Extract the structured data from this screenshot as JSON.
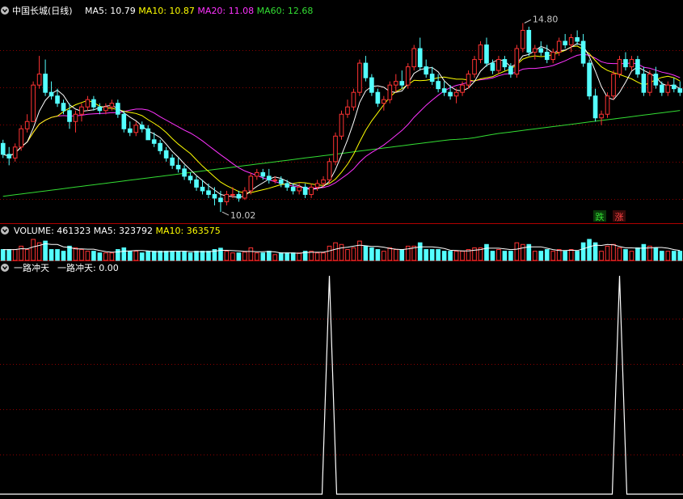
{
  "price_panel": {
    "title": "中国长城(日线)",
    "ma_labels": [
      {
        "text": "MA5: 10.79",
        "color": "#ffffff"
      },
      {
        "text": "MA10: 10.87",
        "color": "#ffff00"
      },
      {
        "text": "MA20: 11.08",
        "color": "#ff33ff"
      },
      {
        "text": "MA60: 12.68",
        "color": "#33dd33"
      }
    ],
    "high_label": "14.80",
    "low_label": "10.02",
    "badges": [
      {
        "text": "跌",
        "color": "#33dd33"
      },
      {
        "text": "涨",
        "color": "#ff4444"
      }
    ]
  },
  "volume_panel": {
    "labels": [
      {
        "text": "VOLUME: 461323",
        "color": "#ffffff"
      },
      {
        "text": "MA5: 323792",
        "color": "#ffffff"
      },
      {
        "text": "MA10: 363575",
        "color": "#ffff00"
      }
    ]
  },
  "indicator_panel": {
    "name": "一路冲天",
    "label": "一路冲天: 0.00"
  },
  "colors": {
    "up": "#ff3333",
    "down": "#54ffff",
    "ma5": "#ffffff",
    "ma10": "#ffff00",
    "ma20": "#ff33ff",
    "ma60": "#33dd33",
    "grid": "#8b0000"
  },
  "chart_data": [
    {
      "type": "candlestick",
      "series_name": "中国长城(日线)",
      "ylim": [
        9.8,
        15.3
      ],
      "candles": [
        [
          11.9,
          12.0,
          11.5,
          11.6
        ],
        [
          11.6,
          11.8,
          11.3,
          11.5
        ],
        [
          11.5,
          11.9,
          11.4,
          11.8
        ],
        [
          11.8,
          12.4,
          11.7,
          12.3
        ],
        [
          12.3,
          12.7,
          12.2,
          12.5
        ],
        [
          12.5,
          13.6,
          12.5,
          13.5
        ],
        [
          13.5,
          14.3,
          13.4,
          13.8
        ],
        [
          13.8,
          14.2,
          13.2,
          13.3
        ],
        [
          13.3,
          13.6,
          13.1,
          13.2
        ],
        [
          13.2,
          13.4,
          12.9,
          13.0
        ],
        [
          13.0,
          13.1,
          12.7,
          12.8
        ],
        [
          12.8,
          13.0,
          12.3,
          12.5
        ],
        [
          12.5,
          12.8,
          12.2,
          12.7
        ],
        [
          12.7,
          13.0,
          12.5,
          12.9
        ],
        [
          12.9,
          13.2,
          12.8,
          13.1
        ],
        [
          13.1,
          13.2,
          12.8,
          12.9
        ],
        [
          12.9,
          13.0,
          12.7,
          12.8
        ],
        [
          12.8,
          13.0,
          12.7,
          12.9
        ],
        [
          12.9,
          13.1,
          12.8,
          13.0
        ],
        [
          13.0,
          13.1,
          12.6,
          12.7
        ],
        [
          12.7,
          12.8,
          12.2,
          12.3
        ],
        [
          12.3,
          12.5,
          12.1,
          12.2
        ],
        [
          12.2,
          12.5,
          12.1,
          12.4
        ],
        [
          12.4,
          12.5,
          12.2,
          12.3
        ],
        [
          12.3,
          12.4,
          12.0,
          12.0
        ],
        [
          12.0,
          12.2,
          11.8,
          11.9
        ],
        [
          11.9,
          12.0,
          11.6,
          11.7
        ],
        [
          11.7,
          11.8,
          11.4,
          11.5
        ],
        [
          11.5,
          11.6,
          11.2,
          11.3
        ],
        [
          11.3,
          11.5,
          11.1,
          11.2
        ],
        [
          11.2,
          11.3,
          10.9,
          11.0
        ],
        [
          11.0,
          11.1,
          10.8,
          10.9
        ],
        [
          10.9,
          11.0,
          10.6,
          10.7
        ],
        [
          10.7,
          10.9,
          10.5,
          10.6
        ],
        [
          10.6,
          10.8,
          10.4,
          10.5
        ],
        [
          10.5,
          10.7,
          10.2,
          10.4
        ],
        [
          10.4,
          10.6,
          10.02,
          10.3
        ],
        [
          10.3,
          10.6,
          10.2,
          10.5
        ],
        [
          10.5,
          10.7,
          10.4,
          10.5
        ],
        [
          10.5,
          10.6,
          10.3,
          10.4
        ],
        [
          10.4,
          10.7,
          10.35,
          10.6
        ],
        [
          10.6,
          11.1,
          10.5,
          11.0
        ],
        [
          11.0,
          11.2,
          10.9,
          11.1
        ],
        [
          11.1,
          11.2,
          10.9,
          11.0
        ],
        [
          11.0,
          11.2,
          10.8,
          10.9
        ],
        [
          10.9,
          11.0,
          10.8,
          10.9
        ],
        [
          10.9,
          11.0,
          10.7,
          10.8
        ],
        [
          10.8,
          10.9,
          10.6,
          10.7
        ],
        [
          10.7,
          10.8,
          10.5,
          10.6
        ],
        [
          10.6,
          10.8,
          10.5,
          10.7
        ],
        [
          10.7,
          10.8,
          10.4,
          10.5
        ],
        [
          10.5,
          10.8,
          10.4,
          10.7
        ],
        [
          10.7,
          10.9,
          10.6,
          10.8
        ],
        [
          10.8,
          11.0,
          10.7,
          10.9
        ],
        [
          10.9,
          11.5,
          10.8,
          11.4
        ],
        [
          11.4,
          12.2,
          11.3,
          12.1
        ],
        [
          12.1,
          12.8,
          12.0,
          12.7
        ],
        [
          12.7,
          13.1,
          12.6,
          12.9
        ],
        [
          12.9,
          13.4,
          12.8,
          13.3
        ],
        [
          13.3,
          14.2,
          13.2,
          14.1
        ],
        [
          14.1,
          14.3,
          13.6,
          13.7
        ],
        [
          13.7,
          13.8,
          13.2,
          13.3
        ],
        [
          13.3,
          13.4,
          12.9,
          13.0
        ],
        [
          13.0,
          13.2,
          12.8,
          13.1
        ],
        [
          13.1,
          13.6,
          13.0,
          13.5
        ],
        [
          13.5,
          13.8,
          13.3,
          13.6
        ],
        [
          13.6,
          13.9,
          13.4,
          13.5
        ],
        [
          13.5,
          14.1,
          13.4,
          14.0
        ],
        [
          14.0,
          14.6,
          13.9,
          14.5
        ],
        [
          14.5,
          14.8,
          13.9,
          14.0
        ],
        [
          14.0,
          14.2,
          13.7,
          13.8
        ],
        [
          13.8,
          14.0,
          13.5,
          13.6
        ],
        [
          13.6,
          13.8,
          13.3,
          13.4
        ],
        [
          13.4,
          13.6,
          13.2,
          13.3
        ],
        [
          13.3,
          13.5,
          13.1,
          13.2
        ],
        [
          13.2,
          13.4,
          13.0,
          13.3
        ],
        [
          13.3,
          13.6,
          13.2,
          13.5
        ],
        [
          13.5,
          13.9,
          13.4,
          13.8
        ],
        [
          13.8,
          14.3,
          13.7,
          14.2
        ],
        [
          14.2,
          14.7,
          14.1,
          14.6
        ],
        [
          14.6,
          14.8,
          14.0,
          14.1
        ],
        [
          14.1,
          14.2,
          13.8,
          13.9
        ],
        [
          13.9,
          14.3,
          13.8,
          14.2
        ],
        [
          14.2,
          14.3,
          13.9,
          14.0
        ],
        [
          14.0,
          14.1,
          13.7,
          13.8
        ],
        [
          13.8,
          14.6,
          13.7,
          14.5
        ],
        [
          14.5,
          15.2,
          14.4,
          15.0
        ],
        [
          15.0,
          15.1,
          14.3,
          14.4
        ],
        [
          14.4,
          14.6,
          14.2,
          14.5
        ],
        [
          14.5,
          14.7,
          14.3,
          14.4
        ],
        [
          14.4,
          14.6,
          14.1,
          14.2
        ],
        [
          14.2,
          14.5,
          14.1,
          14.4
        ],
        [
          14.4,
          14.8,
          14.3,
          14.7
        ],
        [
          14.7,
          14.9,
          14.5,
          14.6
        ],
        [
          14.6,
          14.9,
          14.4,
          14.8
        ],
        [
          14.8,
          15.0,
          14.6,
          14.7
        ],
        [
          14.7,
          14.9,
          14.0,
          14.1
        ],
        [
          14.1,
          14.2,
          13.1,
          13.2
        ],
        [
          13.2,
          13.4,
          12.5,
          12.6
        ],
        [
          12.6,
          12.8,
          12.4,
          12.7
        ],
        [
          12.7,
          13.3,
          12.6,
          13.2
        ],
        [
          13.2,
          13.9,
          13.1,
          13.8
        ],
        [
          13.8,
          14.3,
          13.7,
          14.2
        ],
        [
          14.2,
          14.4,
          13.9,
          14.0
        ],
        [
          14.0,
          14.3,
          13.9,
          14.2
        ],
        [
          14.2,
          14.3,
          13.7,
          13.8
        ],
        [
          13.8,
          14.0,
          13.2,
          13.3
        ],
        [
          13.3,
          13.9,
          13.2,
          13.8
        ],
        [
          13.8,
          14.0,
          13.4,
          13.5
        ],
        [
          13.5,
          13.6,
          13.2,
          13.3
        ],
        [
          13.3,
          13.6,
          13.2,
          13.5
        ],
        [
          13.5,
          13.7,
          13.3,
          13.4
        ],
        [
          13.4,
          13.6,
          13.2,
          13.3
        ]
      ],
      "annotations": [
        {
          "text": "14.80",
          "value": 14.8
        },
        {
          "text": "10.02",
          "value": 10.02
        }
      ]
    },
    {
      "type": "bar",
      "series_name": "VOLUME",
      "ylim": [
        0,
        900000
      ],
      "last_value": 461323,
      "ma5": 323792,
      "ma10": 363575
    },
    {
      "type": "line",
      "series_name": "一路冲天",
      "ylim": [
        0,
        1
      ],
      "last_value": 0.0,
      "spikes_at_candle_index": [
        54,
        102
      ]
    }
  ]
}
